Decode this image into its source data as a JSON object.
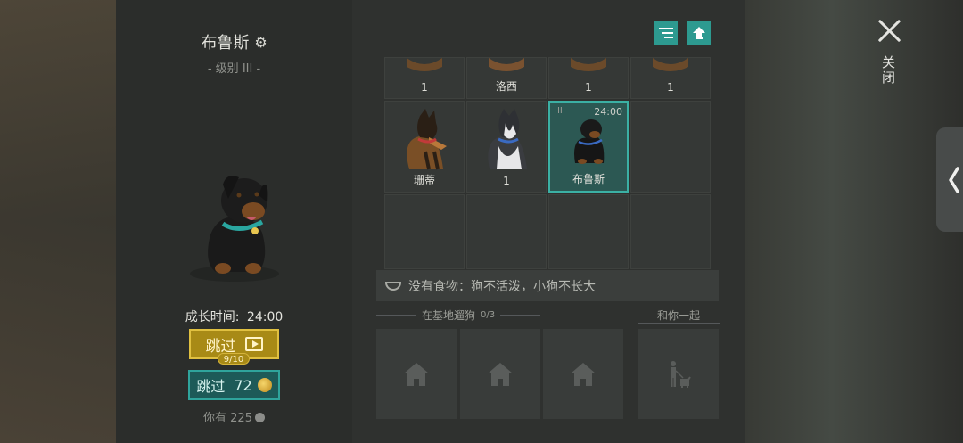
{
  "dog": {
    "name": "布鲁斯",
    "level": "- 级别 III -",
    "grow_label": "成长时间:",
    "grow_time": "24:00"
  },
  "skip_ad": {
    "label": "跳过",
    "count": "9/10"
  },
  "skip_coin": {
    "label": "跳过",
    "cost": "72"
  },
  "have": {
    "label": "你有 225"
  },
  "grid": {
    "row1": [
      {
        "name": "1"
      },
      {
        "name": "洛西"
      },
      {
        "name": "1"
      },
      {
        "name": "1"
      }
    ],
    "row2": [
      {
        "level": "I",
        "name": "珊蒂"
      },
      {
        "level": "I",
        "name": "1"
      },
      {
        "level": "III",
        "time": "24:00",
        "name": "布鲁斯"
      }
    ]
  },
  "food_message": "没有食物：狗不活泼，小狗不长大",
  "base": {
    "label": "在基地遛狗",
    "count": "0/3"
  },
  "with_you_label": "和你一起",
  "close_label": "关闭",
  "icons": {
    "settings": "gear-icon",
    "sort": "sort-icon",
    "upgrade": "arrow-up-icon",
    "home": "house-icon",
    "walker": "person-with-dog-icon",
    "back": "chevron-left-icon"
  },
  "colors": {
    "accent_teal": "#2d9a90",
    "gold": "#a88a16"
  }
}
